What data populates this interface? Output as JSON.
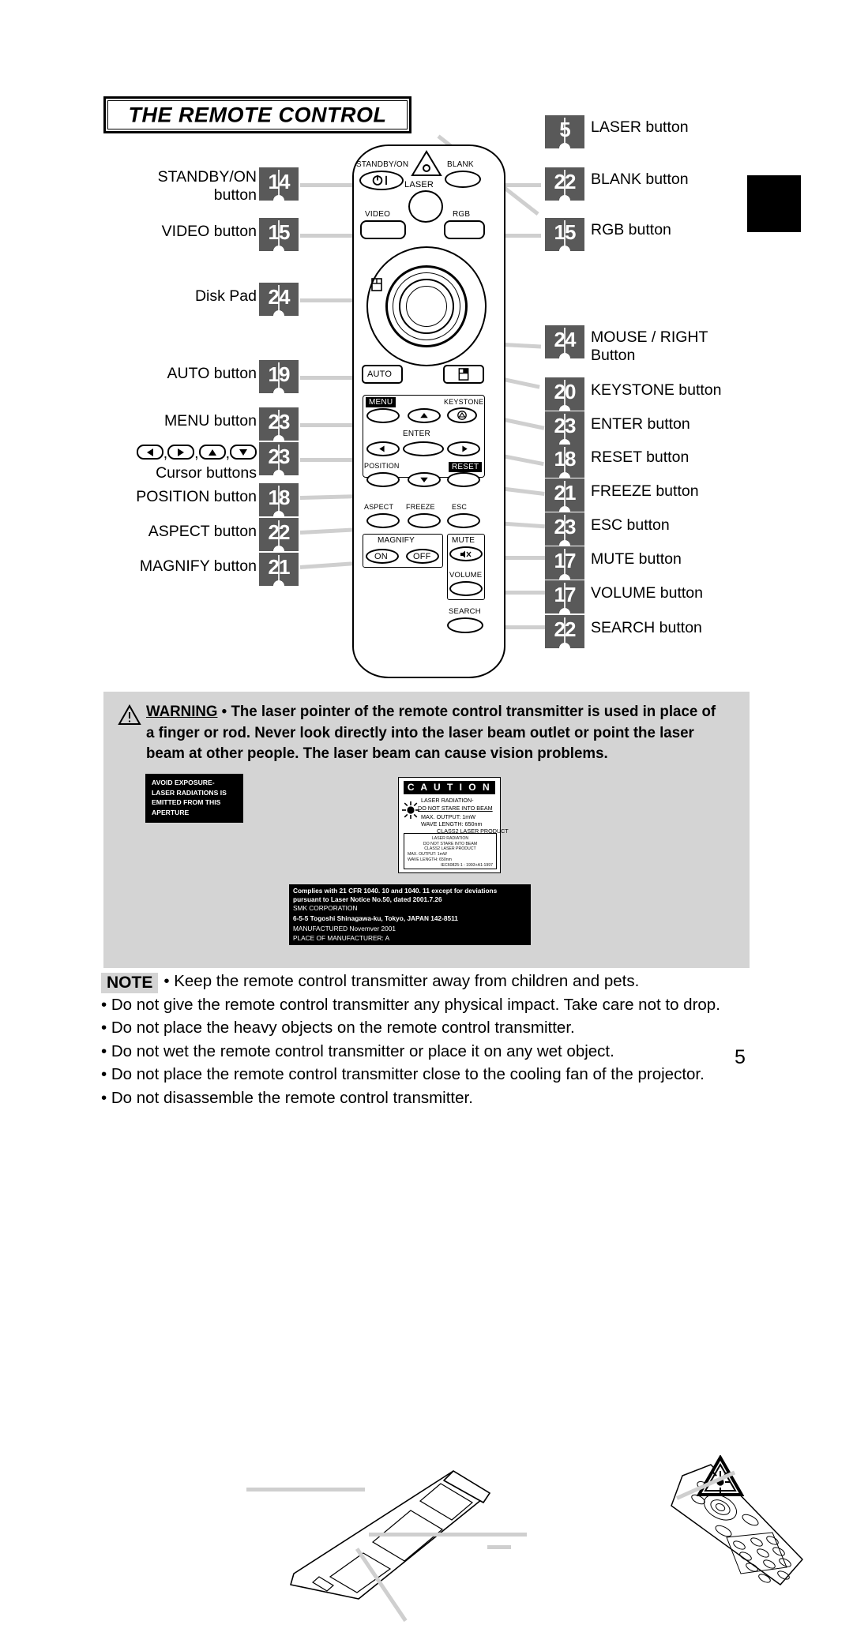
{
  "title": "THE REMOTE CONTROL",
  "page_number": "5",
  "callouts_left": [
    {
      "label_line1": "STANDBY/ON",
      "label_line2": "button",
      "page": "14",
      "name": "standby-on"
    },
    {
      "label_line1": "VIDEO button",
      "label_line2": "",
      "page": "15",
      "name": "video"
    },
    {
      "label_line1": "Disk Pad",
      "label_line2": "",
      "page": "24",
      "name": "disk-pad"
    },
    {
      "label_line1": "AUTO button",
      "label_line2": "",
      "page": "19",
      "name": "auto"
    },
    {
      "label_line1": "MENU button",
      "label_line2": "",
      "page": "23",
      "name": "menu"
    },
    {
      "label_line1": "",
      "label_line2": "Cursor buttons",
      "page": "23",
      "name": "cursor"
    },
    {
      "label_line1": "POSITION button",
      "label_line2": "",
      "page": "18",
      "name": "position"
    },
    {
      "label_line1": "ASPECT button",
      "label_line2": "",
      "page": "22",
      "name": "aspect"
    },
    {
      "label_line1": "MAGNIFY button",
      "label_line2": "",
      "page": "21",
      "name": "magnify"
    }
  ],
  "callouts_right": [
    {
      "page": "5",
      "label_line1": "LASER button",
      "label_line2": "",
      "name": "laser"
    },
    {
      "page": "22",
      "label_line1": "BLANK button",
      "label_line2": "",
      "name": "blank"
    },
    {
      "page": "15",
      "label_line1": "RGB button",
      "label_line2": "",
      "name": "rgb"
    },
    {
      "page": "24",
      "label_line1": "MOUSE / RIGHT",
      "label_line2": "Button",
      "name": "mouse-right"
    },
    {
      "page": "20",
      "label_line1": "KEYSTONE button",
      "label_line2": "",
      "name": "keystone"
    },
    {
      "page": "23",
      "label_line1": "ENTER button",
      "label_line2": "",
      "name": "enter"
    },
    {
      "page": "18",
      "label_line1": "RESET button",
      "label_line2": "",
      "name": "reset"
    },
    {
      "page": "21",
      "label_line1": "FREEZE button",
      "label_line2": "",
      "name": "freeze"
    },
    {
      "page": "23",
      "label_line1": "ESC button",
      "label_line2": "",
      "name": "esc"
    },
    {
      "page": "17",
      "label_line1": "MUTE button",
      "label_line2": "",
      "name": "mute"
    },
    {
      "page": "17",
      "label_line1": "VOLUME button",
      "label_line2": "",
      "name": "volume"
    },
    {
      "page": "22",
      "label_line1": "SEARCH button",
      "label_line2": "",
      "name": "search"
    }
  ],
  "remote_labels": {
    "standby_on": "STANDBY/ON",
    "laser": "LASER",
    "blank": "BLANK",
    "video": "VIDEO",
    "rgb": "RGB",
    "auto": "AUTO",
    "menu": "MENU",
    "keystone": "KEYSTONE",
    "enter": "ENTER",
    "position": "POSITION",
    "reset": "RESET",
    "aspect": "ASPECT",
    "freeze": "FREEZE",
    "esc": "ESC",
    "magnify": "MAGNIFY",
    "magnify_on": "ON",
    "magnify_off": "OFF",
    "mute": "MUTE",
    "volume": "VOLUME",
    "search": "SEARCH"
  },
  "warning": {
    "heading": "WARNING",
    "body": "• The laser pointer of the remote control transmitter is used in place of a finger or rod. Never look directly into the laser beam outlet or point the laser beam at other people. The laser beam can cause vision problems."
  },
  "aperture_label": {
    "line1": "AVOID EXPOSURE-",
    "line2": "LASER RADIATIONS IS",
    "line3": "EMITTED FROM THIS",
    "line4": "APERTURE"
  },
  "caution_label": {
    "heading": "C A U T I O N",
    "line1": "LASER  RADIATION-",
    "line2": "DO NOT STARE INTO BEAM",
    "line3": "MAX. OUTPUT: 1mW",
    "line4": "WAVE LENGTH:   650nm",
    "line5": "CLASS2 LASER PRODUCT",
    "inner": {
      "line1": "LASER RADIATION",
      "line2": "DO NOT STARE  INTO BEAM",
      "line3": "CLASS2 LASER PRODUCT",
      "line4": "MAX.  OUTPUT: 1mW",
      "line5": "WAVE LENGTH: 650nm",
      "line6": "IEC60825-1 : 1993+A1:1997"
    }
  },
  "compliance": {
    "line1": "Complies with 21 CFR 1040. 10 and 1040. 11 except for deviations",
    "line2": "pursuant  to  Laser  Notice  No.50,  dated  2001.7.26",
    "line3": "SMK CORPORATION",
    "line4": "6-5-5  Togoshi  Shinagawa-ku,  Tokyo,  JAPAN  142-8511",
    "line5": "MANUFACTURED   Novemver  2001",
    "line6": "PLACE OF  MANUFACTURER:  A"
  },
  "note": {
    "badge": "NOTE",
    "items": [
      "• Keep the remote control transmitter away from children and pets.",
      "• Do not give the remote control transmitter any physical impact. Take care not to drop.",
      "• Do not place the heavy objects on the remote control transmitter.",
      "• Do not wet the remote control transmitter or place it on any wet object.",
      "• Do not place the remote control transmitter close to the cooling fan of the projector.",
      "• Do not disassemble the remote control transmitter."
    ]
  }
}
